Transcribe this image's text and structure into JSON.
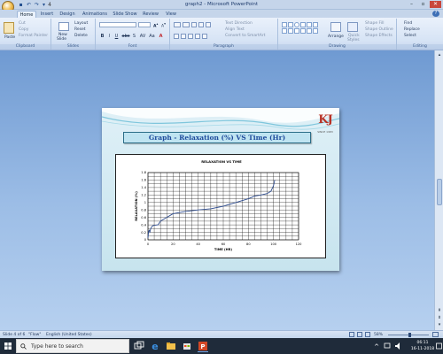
{
  "window": {
    "title": "graph2 - Microsoft PowerPoint",
    "qat_count": "4"
  },
  "tabs": [
    {
      "label": "Home",
      "active": true
    },
    {
      "label": "Insert"
    },
    {
      "label": "Design"
    },
    {
      "label": "Animations"
    },
    {
      "label": "Slide Show"
    },
    {
      "label": "Review"
    },
    {
      "label": "View"
    }
  ],
  "ribbon": {
    "clipboard": {
      "label": "Clipboard",
      "paste": "Paste",
      "cut": "Cut",
      "copy": "Copy",
      "format_painter": "Format Painter"
    },
    "slides": {
      "label": "Slides",
      "new_slide_line1": "New",
      "new_slide_line2": "Slide",
      "layout": "Layout",
      "reset": "Reset",
      "delete": "Delete"
    },
    "font": {
      "label": "Font",
      "bold": "B",
      "italic": "I",
      "underline": "U",
      "strike": "abc",
      "shadow": "S",
      "spacing": "AV",
      "case": "Aa",
      "color": "A"
    },
    "paragraph": {
      "label": "Paragraph",
      "text_direction": "Text Direction",
      "align_text": "Align Text",
      "smartart": "Convert to SmartArt"
    },
    "drawing": {
      "label": "Drawing",
      "arrange": "Arrange",
      "quick_styles_line1": "Quick",
      "quick_styles_line2": "Styles",
      "shape_fill": "Shape Fill",
      "shape_outline": "Shape Outline",
      "shape_effects": "Shape Effects"
    },
    "editing": {
      "label": "Editing",
      "find": "Find",
      "replace": "Replace",
      "select": "Select"
    }
  },
  "slide": {
    "title": "Graph - Relaxation (%) VS Time (Hr)",
    "logo_tagline": "SINCE 1983"
  },
  "chart_data": {
    "type": "line",
    "title": "RELAXATION VS TIME",
    "xlabel": "TIME (HR)",
    "ylabel": "RELAXATION (%)",
    "xlim": [
      0,
      120
    ],
    "ylim": [
      0,
      1.8
    ],
    "xticks": [
      "0",
      "20",
      "40",
      "60",
      "80",
      "100",
      "120"
    ],
    "yticks": [
      "0",
      "0.2",
      "0.4",
      "0.6",
      "0.8",
      "1",
      "1.2",
      "1.4",
      "1.6",
      "1.8"
    ],
    "grid": true,
    "series_color": "#2f4d8f",
    "series": [
      {
        "x": [
          0,
          0.5,
          1,
          1.5,
          2,
          3,
          4,
          5,
          8,
          10,
          15,
          20,
          30,
          40,
          50,
          60,
          70,
          80,
          85,
          90,
          95,
          98,
          100,
          101
        ],
        "y": [
          0.05,
          0.22,
          0.26,
          0.2,
          0.28,
          0.35,
          0.38,
          0.39,
          0.4,
          0.5,
          0.6,
          0.7,
          0.76,
          0.8,
          0.83,
          0.9,
          1.0,
          1.1,
          1.17,
          1.2,
          1.24,
          1.3,
          1.45,
          1.6
        ]
      }
    ]
  },
  "status": {
    "slide_of": "Slide 4 of 6",
    "theme": "\"Flow\"",
    "language": "English (United States)",
    "zoom": "58%"
  },
  "taskbar": {
    "search_placeholder": "Type here to search",
    "time": "06:11",
    "date": "16-11-2018"
  }
}
